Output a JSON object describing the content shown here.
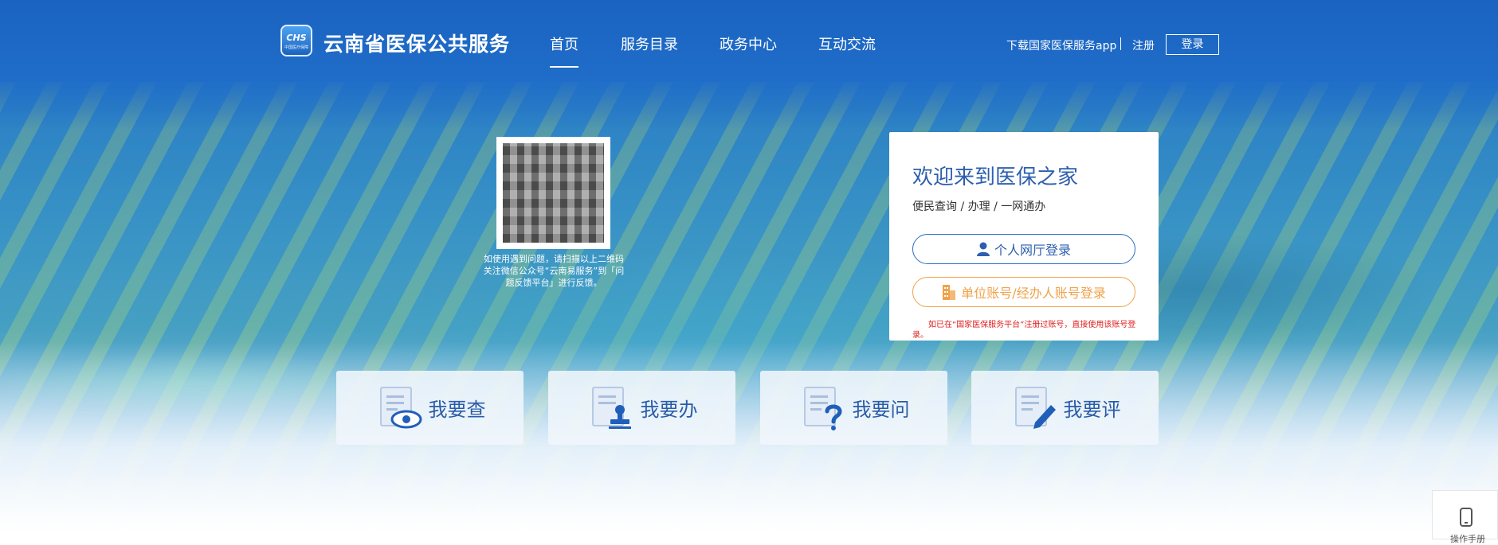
{
  "header": {
    "logo_text": "CHS",
    "logo_sub": "中国医疗保障",
    "site_title": "云南省医保公共服务",
    "nav": [
      {
        "label": "首页",
        "active": true
      },
      {
        "label": "服务目录",
        "active": false
      },
      {
        "label": "政务中心",
        "active": false
      },
      {
        "label": "互动交流",
        "active": false
      }
    ],
    "download_app": "下载国家医保服务app",
    "register": "注册",
    "login": "登录"
  },
  "qr": {
    "caption": "如使用遇到问题，请扫描以上二维码关注微信公众号“云南易服务”到「问题反馈平台」进行反馈。"
  },
  "login_card": {
    "title": "欢迎来到医保之家",
    "subtitle": "便民查询 / 办理 / 一网通办",
    "personal_login": "个人网厅登录",
    "company_login": "单位账号/经办人账号登录",
    "note": "如已在“国家医保服务平台”注册过账号，直接使用该账号登录。"
  },
  "tiles": [
    {
      "label": "我要查",
      "icon": "search-eye-icon"
    },
    {
      "label": "我要办",
      "icon": "stamp-icon"
    },
    {
      "label": "我要问",
      "icon": "question-icon"
    },
    {
      "label": "我要评",
      "icon": "pen-icon"
    }
  ],
  "side_widget": {
    "label": "操作手册",
    "icon": "phone-icon"
  },
  "colors": {
    "header_bg": "#1f6dc9",
    "accent_blue": "#2d5fae",
    "company_orange": "#f0a24a",
    "note_red": "#e02020"
  }
}
